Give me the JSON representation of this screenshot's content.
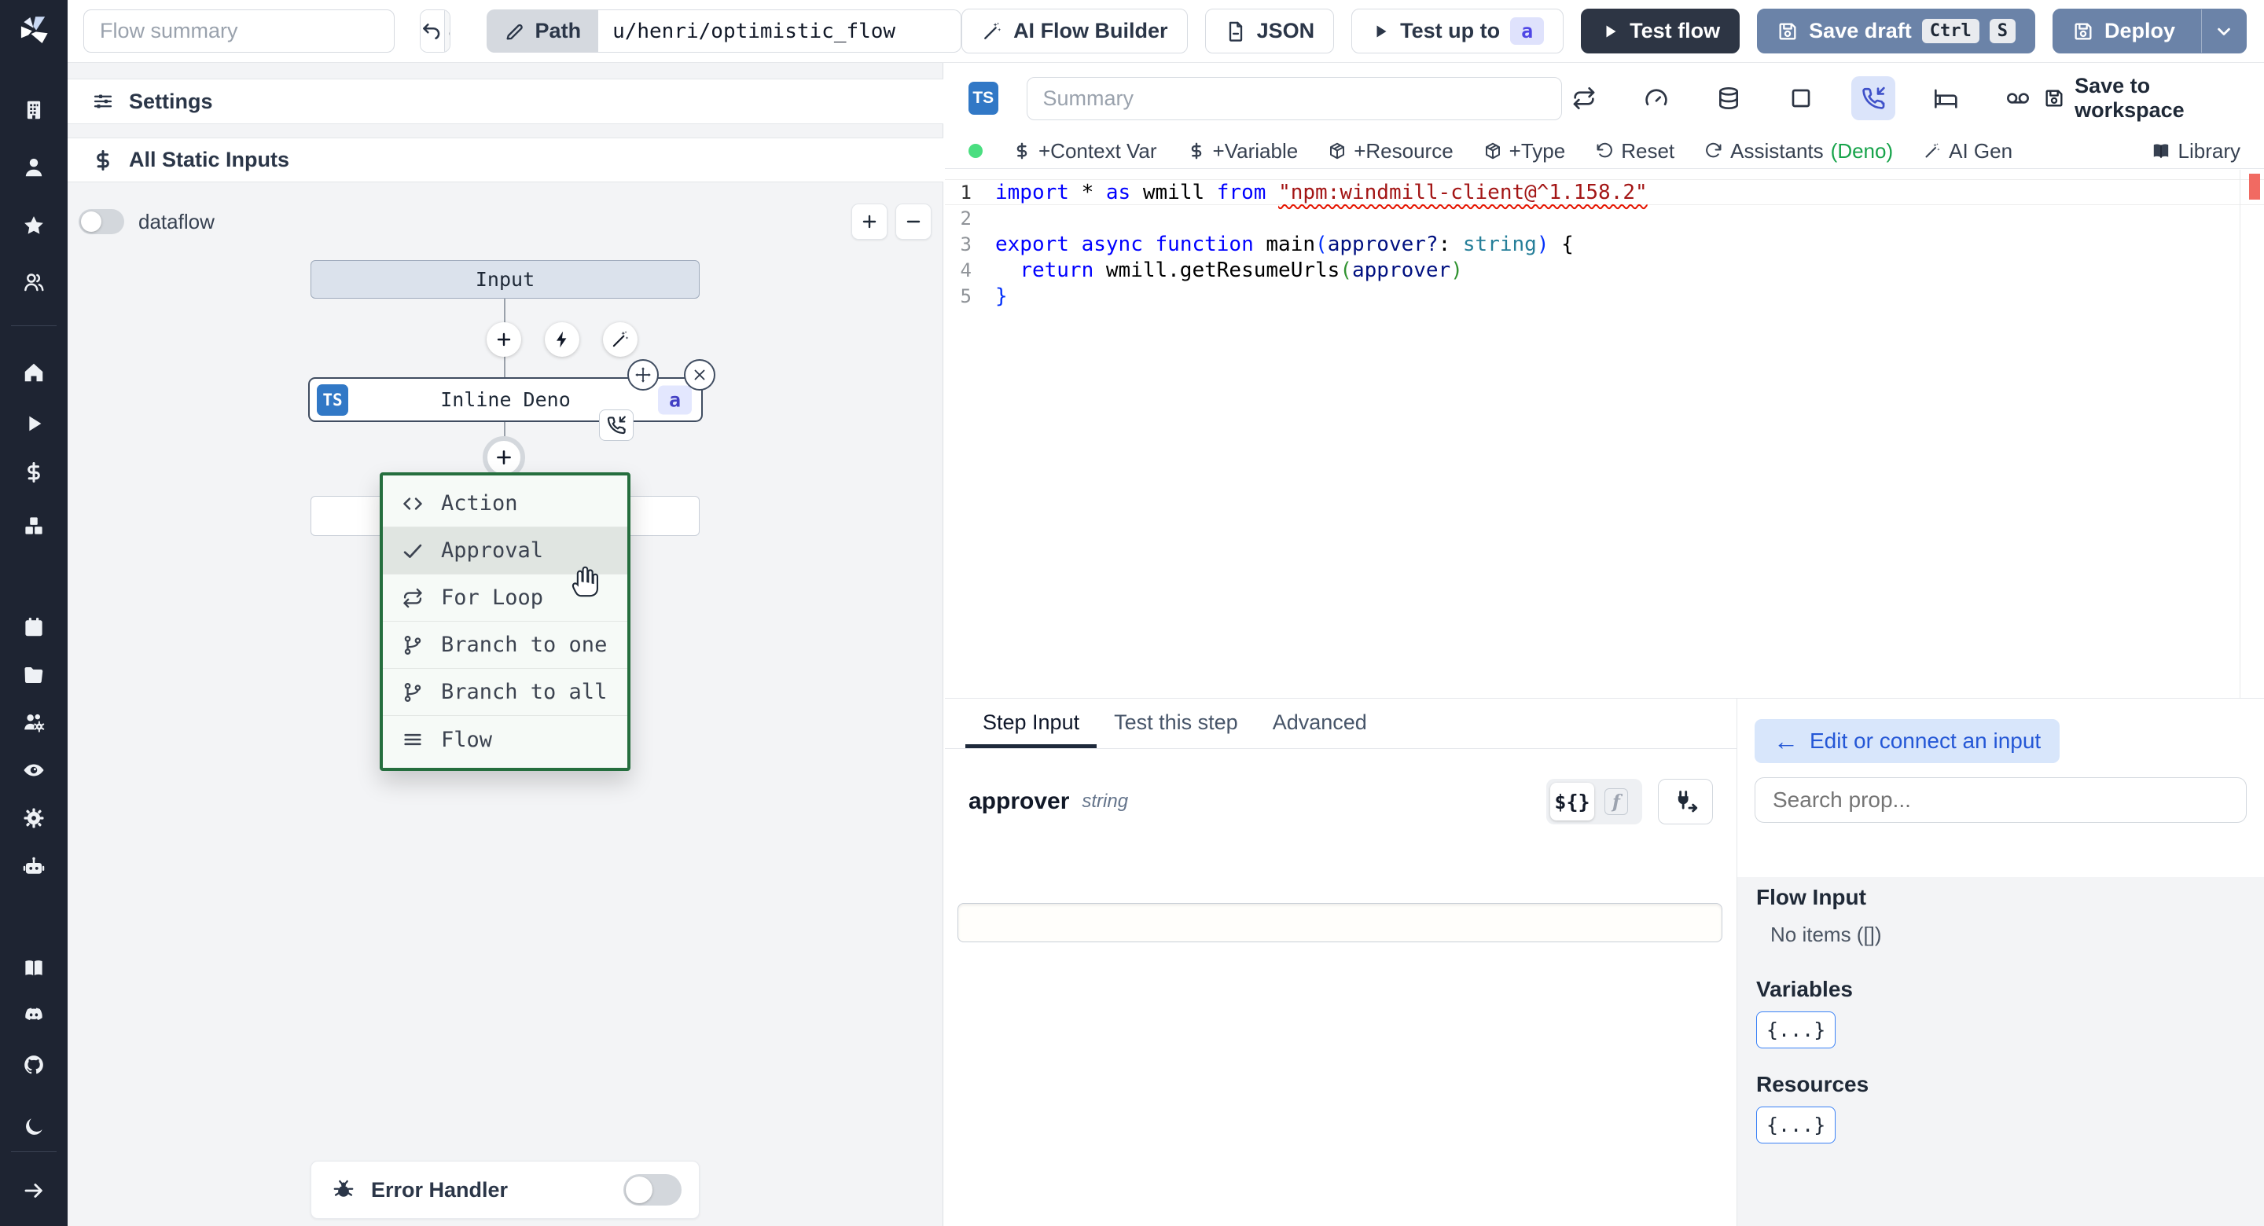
{
  "topbar": {
    "flow_summary_placeholder": "Flow summary",
    "path_label": "Path",
    "path_value": "u/henri/optimistic_flow",
    "ai_flow_builder": "AI Flow Builder",
    "json": "JSON",
    "test_up_to": "Test up to",
    "test_up_to_badge": "a",
    "test_flow": "Test flow",
    "save_draft": "Save draft",
    "save_draft_kbd": [
      "Ctrl",
      "S"
    ],
    "deploy": "Deploy"
  },
  "colors": {
    "sidebar_bg": "#1e2432",
    "slate_button": "#6b83a8",
    "dark_button": "#2d3544",
    "menu_border_green": "#256e3e",
    "badge_indigo_bg": "#dfe2fc",
    "badge_indigo_text": "#4f46e5",
    "ts_badge_blue": "#3178c6",
    "accent_blue": "#3b82f6",
    "assistants_green": "#16a34a",
    "status_dot_green": "#4ade80",
    "error_squiggle": "#e51400"
  },
  "sidebar": {
    "items": [
      {
        "icon": "building"
      },
      {
        "icon": "user"
      },
      {
        "icon": "star"
      },
      {
        "icon": "users"
      },
      {
        "divider": true
      },
      {
        "icon": "home"
      },
      {
        "icon": "play"
      },
      {
        "icon": "dollar"
      },
      {
        "icon": "boxes"
      },
      {
        "icon": "calendar"
      },
      {
        "icon": "folder"
      },
      {
        "icon": "users-cog"
      },
      {
        "icon": "eye"
      },
      {
        "icon": "gear"
      },
      {
        "icon": "bot"
      },
      {
        "icon": "book"
      },
      {
        "icon": "discord"
      },
      {
        "icon": "github"
      },
      {
        "icon": "moon"
      },
      {
        "divider": true
      },
      {
        "icon": "arrow-right"
      }
    ]
  },
  "left_panel": {
    "settings_label": "Settings",
    "all_static_inputs_label": "All Static Inputs",
    "dataflow_label": "dataflow",
    "error_handler_label": "Error Handler"
  },
  "graph": {
    "input_label": "Input",
    "step": {
      "lang": "TS",
      "label": "Inline Deno",
      "badge": "a"
    }
  },
  "context_menu": {
    "items": [
      {
        "icon": "code",
        "label": "Action"
      },
      {
        "icon": "check",
        "label": "Approval",
        "hovered": true
      },
      {
        "icon": "repeat",
        "label": "For Loop"
      },
      {
        "icon": "git-branch",
        "label": "Branch to one"
      },
      {
        "icon": "git-branch",
        "label": "Branch to all"
      },
      {
        "icon": "menu",
        "label": "Flow"
      }
    ]
  },
  "editor": {
    "lang_badge": "TS",
    "summary_placeholder": "Summary",
    "save_to_workspace": "Save to workspace",
    "header_icons": [
      {
        "icon": "repeat"
      },
      {
        "icon": "gauge"
      },
      {
        "icon": "database"
      },
      {
        "icon": "square"
      },
      {
        "icon": "phone-in",
        "active": true
      },
      {
        "icon": "bed"
      },
      {
        "icon": "voicemail"
      }
    ],
    "toolbar": {
      "items": [
        {
          "icon": "dollar",
          "label": "+Context Var"
        },
        {
          "icon": "dollar",
          "label": "+Variable"
        },
        {
          "icon": "package",
          "label": "+Resource"
        },
        {
          "icon": "package",
          "label": "+Type"
        },
        {
          "icon": "rotate-ccw",
          "label": "Reset"
        },
        {
          "icon": "refresh-cw",
          "label": "Assistants",
          "suffix": "(Deno)"
        },
        {
          "icon": "wand",
          "label": "AI Gen"
        }
      ],
      "library_label": "Library"
    },
    "code_lines": [
      {
        "n": "1",
        "current": true,
        "tokens": [
          [
            "kw",
            "import"
          ],
          [
            "tx",
            " * "
          ],
          [
            "kw",
            "as"
          ],
          [
            "tx",
            " wmill "
          ],
          [
            "kw",
            "from"
          ],
          [
            "tx",
            " "
          ],
          [
            "se",
            "\"npm:windmill-client@^1.158.2\""
          ]
        ]
      },
      {
        "n": "2",
        "tokens": []
      },
      {
        "n": "3",
        "tokens": [
          [
            "kw",
            "export"
          ],
          [
            "tx",
            " "
          ],
          [
            "kw",
            "async"
          ],
          [
            "tx",
            " "
          ],
          [
            "kw",
            "function"
          ],
          [
            "tx",
            " main"
          ],
          [
            "p1",
            "("
          ],
          [
            "pm",
            "approver?"
          ],
          [
            "tx",
            ": "
          ],
          [
            "ty",
            "string"
          ],
          [
            "p1",
            ")"
          ],
          [
            "tx",
            " {"
          ]
        ]
      },
      {
        "n": "4",
        "tokens": [
          [
            "tx",
            "  "
          ],
          [
            "kw",
            "return"
          ],
          [
            "tx",
            " wmill.getResumeUrls"
          ],
          [
            "p2",
            "("
          ],
          [
            "pm",
            "approver"
          ],
          [
            "p2",
            ")"
          ]
        ]
      },
      {
        "n": "5",
        "tokens": [
          [
            "p1",
            "}"
          ]
        ]
      }
    ]
  },
  "step_panel": {
    "tabs": [
      {
        "label": "Step Input",
        "active": true
      },
      {
        "label": "Test this step"
      },
      {
        "label": "Advanced"
      }
    ],
    "field_name": "approver",
    "field_type": "string",
    "field_value": "",
    "template_toggle": "${}",
    "fn_toggle": "f"
  },
  "props_panel": {
    "edit_connect_label": "Edit or connect an input",
    "back_arrow": "←",
    "search_placeholder": "Search prop...",
    "flow_input_title": "Flow Input",
    "flow_input_empty": "No items ([])",
    "variables_title": "Variables",
    "variables_chip": "{...}",
    "resources_title": "Resources",
    "resources_chip": "{...}"
  }
}
